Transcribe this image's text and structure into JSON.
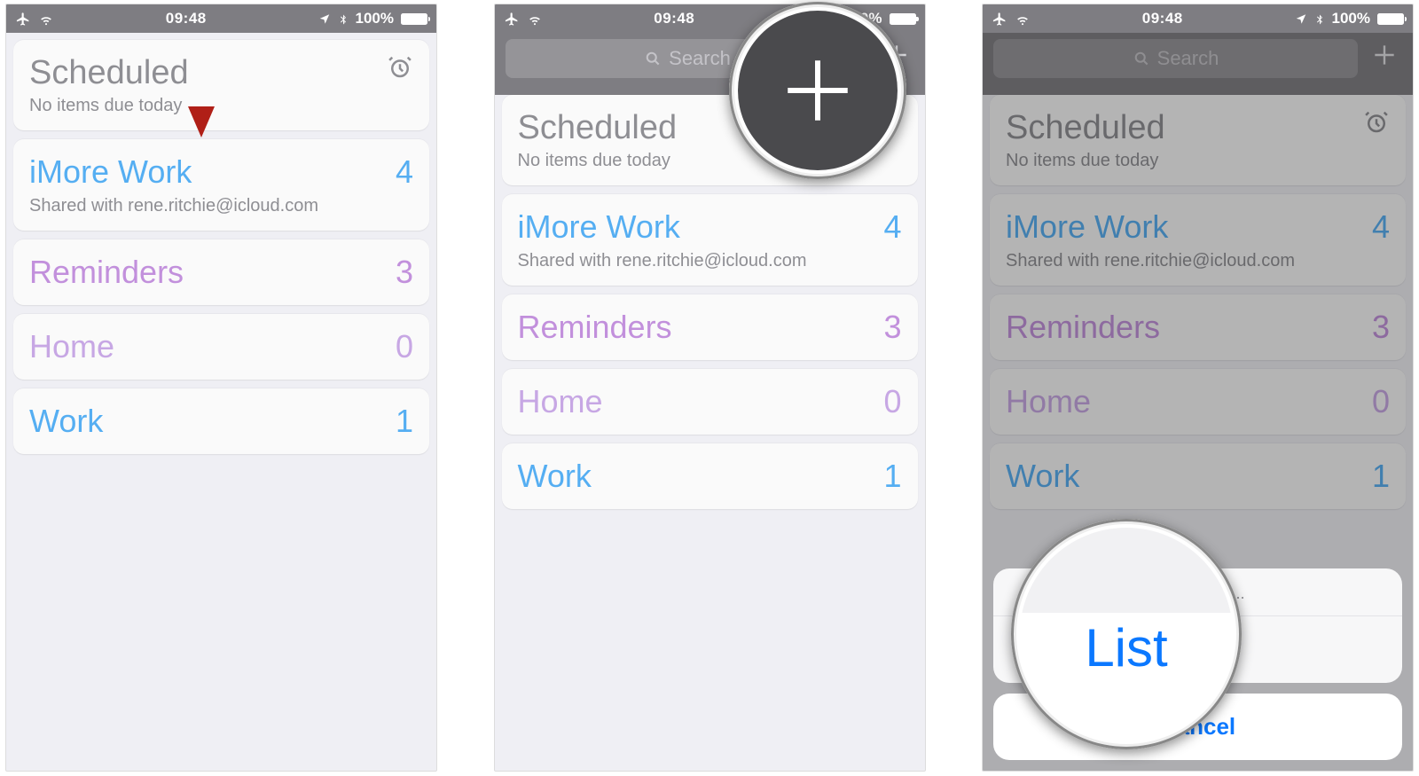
{
  "status_bar": {
    "time": "09:48",
    "battery_pct": "100%"
  },
  "scheduled": {
    "title": "Scheduled",
    "subtitle": "No items due today"
  },
  "search_placeholder": "Search",
  "lists": [
    {
      "name": "iMore Work",
      "count": "4",
      "color": "c-blue",
      "shared_with": "Shared with rene.ritchie@icloud.com"
    },
    {
      "name": "Reminders",
      "count": "3",
      "color": "c-violet",
      "shared_with": ""
    },
    {
      "name": "Home",
      "count": "0",
      "color": "c-lavender",
      "shared_with": ""
    },
    {
      "name": "Work",
      "count": "1",
      "color": "c-blue",
      "shared_with": ""
    }
  ],
  "action_sheet": {
    "title": "Create new...",
    "option_list": "List",
    "cancel": "Cancel"
  },
  "lens": {
    "plus_label": "+",
    "list_label": "List"
  }
}
